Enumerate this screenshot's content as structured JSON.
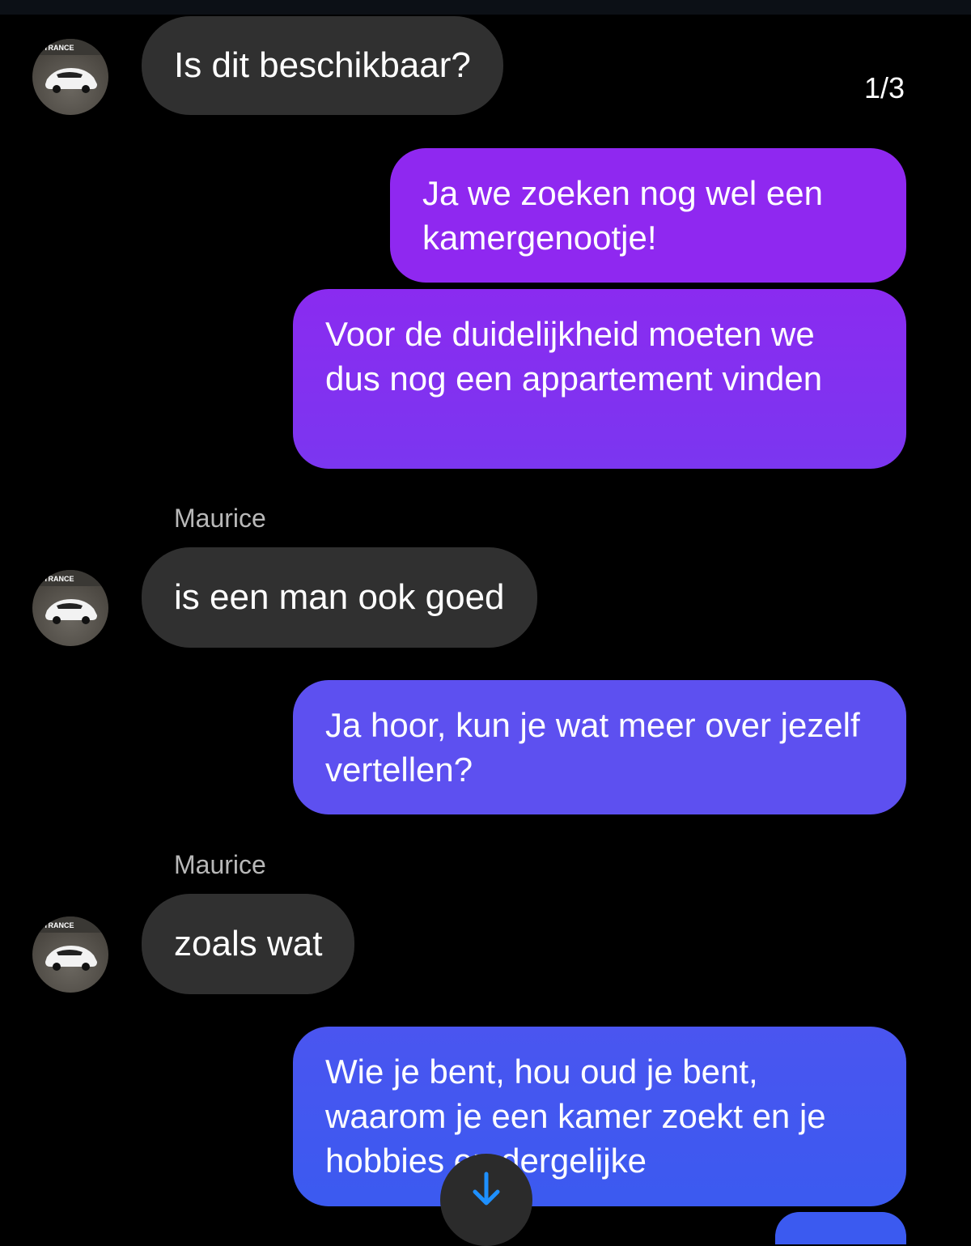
{
  "pager": {
    "counter": "1/3"
  },
  "avatar": {
    "logo_text": "TRANCE"
  },
  "messages": [
    {
      "id": "m1",
      "text": "Is dit beschikbaar?"
    },
    {
      "id": "m2",
      "text": "Ja we zoeken nog wel een kamergenootje!"
    },
    {
      "id": "m3",
      "text": "Voor de duidelijkheid moeten we dus nog een appartement vinden"
    },
    {
      "id": "m4",
      "sender": "Maurice",
      "text": "is een man ook goed"
    },
    {
      "id": "m5",
      "text": "Ja hoor, kun je wat meer over jezelf vertellen?"
    },
    {
      "id": "m6",
      "sender": "Maurice",
      "text": "zoals wat"
    },
    {
      "id": "m7",
      "text": "Wie je bent, hou oud je bent, waarom je een kamer zoekt en je hobbies en dergelijke"
    }
  ],
  "colors": {
    "incoming_bubble": "#303030",
    "outgoing_gradient": [
      "#9a1ff0",
      "#7a3af0",
      "#5a52f0",
      "#3b5af0"
    ],
    "scroll_arrow": "#1e90ff"
  },
  "icons": {
    "scroll_down": "arrow-down-icon",
    "avatar": "car-avatar-icon"
  }
}
